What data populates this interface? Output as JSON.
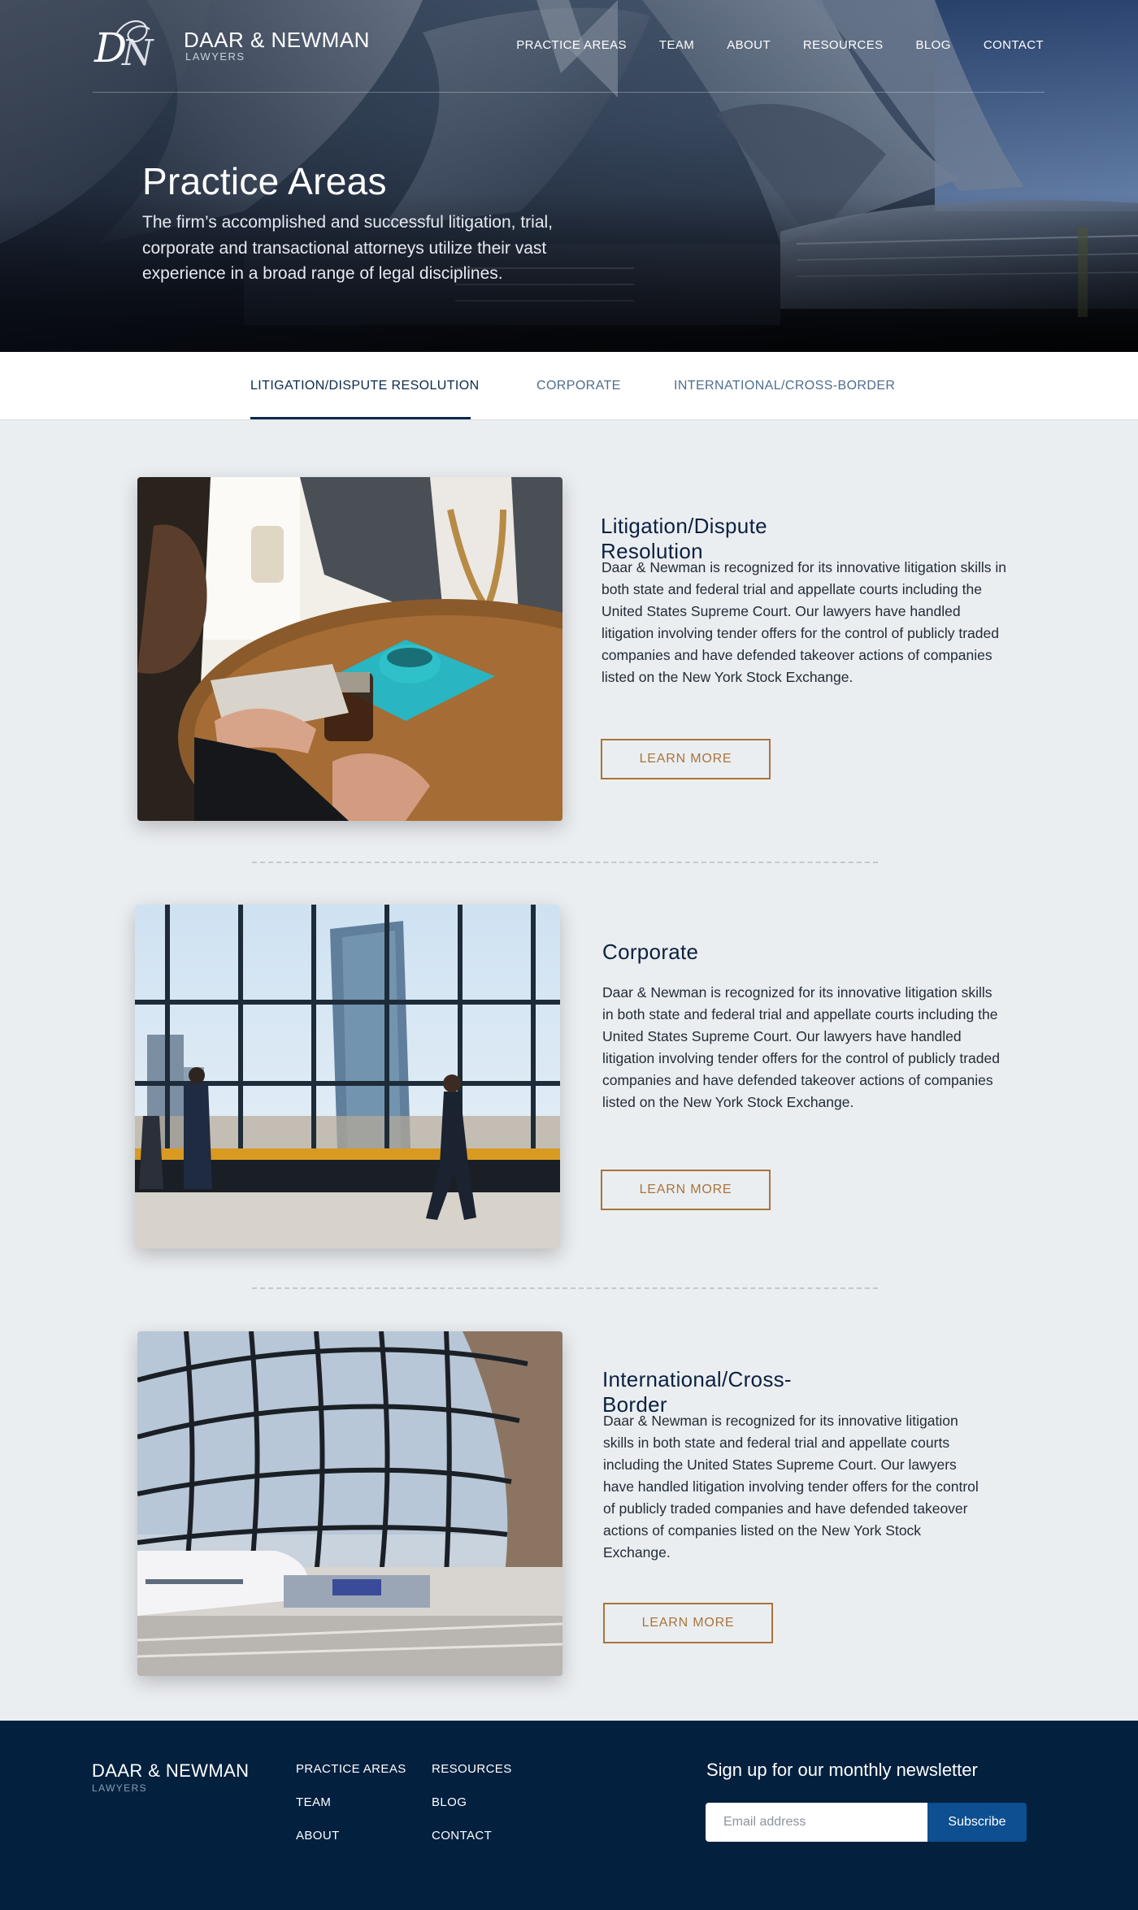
{
  "brand": {
    "monogram": "DN",
    "name": "DAAR & NEWMAN",
    "sub": "LAWYERS"
  },
  "nav": {
    "items": [
      {
        "label": "PRACTICE AREAS"
      },
      {
        "label": "TEAM"
      },
      {
        "label": "ABOUT"
      },
      {
        "label": "RESOURCES"
      },
      {
        "label": "BLOG"
      },
      {
        "label": "CONTACT"
      }
    ]
  },
  "hero": {
    "title": "Practice Areas",
    "text": "The firm’s accomplished and successful litigation, trial, corporate and transactional attorneys utilize their vast experience in a broad range of legal disciplines."
  },
  "tabs": {
    "items": [
      {
        "label": "LITIGATION/DISPUTE RESOLUTION",
        "active": true
      },
      {
        "label": "CORPORATE",
        "active": false
      },
      {
        "label": "INTERNATIONAL/CROSS-BORDER",
        "active": false
      }
    ]
  },
  "sections": [
    {
      "title": "Litigation/Dispute Resolution",
      "body": "Daar & Newman is recognized for its innovative litigation skills in both state and federal trial and appellate courts including the United States Supreme Court.  Our lawyers have handled litigation involving tender offers for the control of publicly traded companies and have defended takeover actions of companies listed on the New York Stock Exchange.",
      "button": "LEARN MORE",
      "image": "meeting-photo"
    },
    {
      "title": "Corporate",
      "body": "Daar & Newman is recognized for its innovative litigation skills in both state and federal trial and appellate courts including the United States Supreme Court.  Our lawyers have handled litigation involving tender offers for the control of publicly traded companies and have defended takeover actions of companies listed on the New York Stock Exchange.",
      "button": "LEARN MORE",
      "image": "office-window-photo"
    },
    {
      "title": "International/Cross-Border",
      "body": "Daar & Newman is recognized for its innovative litigation skills in both state and federal trial and appellate courts including the United States Supreme Court.  Our lawyers have handled litigation involving tender offers for the control of publicly traded companies and have defended takeover actions of companies listed on the New York Stock Exchange.",
      "button": "LEARN MORE",
      "image": "airport-terminal-photo"
    }
  ],
  "footer": {
    "brand_name": "DAAR & NEWMAN",
    "brand_sub": "LAWYERS",
    "links_col1": [
      "PRACTICE AREAS",
      "TEAM",
      "ABOUT"
    ],
    "links_col2": [
      "RESOURCES",
      "BLOG",
      "CONTACT"
    ],
    "newsletter": {
      "title": "Sign up for our monthly newsletter",
      "placeholder": "Email address",
      "button": "Subscribe"
    }
  },
  "colors": {
    "accent": "#a8753a",
    "navy": "#04203f",
    "tab_active": "#0b2a4c",
    "subscribe": "#0d4f91",
    "background": "#ebeef1"
  }
}
